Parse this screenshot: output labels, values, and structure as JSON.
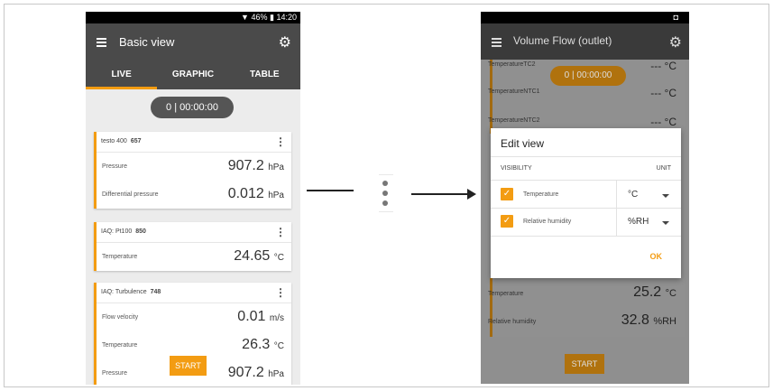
{
  "left_phone": {
    "status": {
      "battery": "46%",
      "time": "14:20",
      "signal_icon": "wifi-icon"
    },
    "title": "Basic view",
    "tabs": [
      "LIVE",
      "GRAPHIC",
      "TABLE"
    ],
    "active_tab": "LIVE",
    "timer": "0 | 00:00:00",
    "cards": [
      {
        "device": "testo 400",
        "serial": "657",
        "rows": [
          {
            "label": "Pressure",
            "value": "907.2",
            "unit": "hPa"
          },
          {
            "label": "Differential pressure",
            "value": "0.012",
            "unit": "hPa"
          }
        ]
      },
      {
        "device": "IAQ: Pt100",
        "serial": "850",
        "rows": [
          {
            "label": "Temperature",
            "value": "24.65",
            "unit": "°C"
          }
        ]
      },
      {
        "device": "IAQ: Turbulence",
        "serial": "748",
        "rows": [
          {
            "label": "Flow velocity",
            "value": "0.01",
            "unit": "m/s"
          },
          {
            "label": "Temperature",
            "value": "26.3",
            "unit": "°C"
          },
          {
            "label": "Pressure",
            "value": "907.2",
            "unit": "hPa"
          }
        ]
      }
    ],
    "start_label": "START",
    "kebab": "⋮"
  },
  "right_phone": {
    "title": "Volume Flow (outlet)",
    "timer": "0 | 00:00:00",
    "background_rows": [
      {
        "label": "TemperatureTC2",
        "value": "--- °C"
      },
      {
        "label": "TemperatureNTC1",
        "value": "--- °C"
      },
      {
        "label": "TemperatureNTC2",
        "value": "--- °C"
      }
    ],
    "background_rows_bottom": [
      {
        "label": "Temperature",
        "value": "25.2",
        "unit": "°C"
      },
      {
        "label": "Relative humidity",
        "value": "32.8",
        "unit": "%RH"
      }
    ],
    "dialog": {
      "title": "Edit view",
      "col_visibility": "VISIBILITY",
      "col_unit": "UNIT",
      "items": [
        {
          "label": "Temperature",
          "unit": "°C",
          "checked": true
        },
        {
          "label": "Relative humidity",
          "unit": "%RH",
          "checked": true
        }
      ],
      "ok_label": "OK"
    },
    "start_label": "START"
  },
  "colors": {
    "accent": "#f39c12",
    "appbar": "#4a4a4a"
  }
}
